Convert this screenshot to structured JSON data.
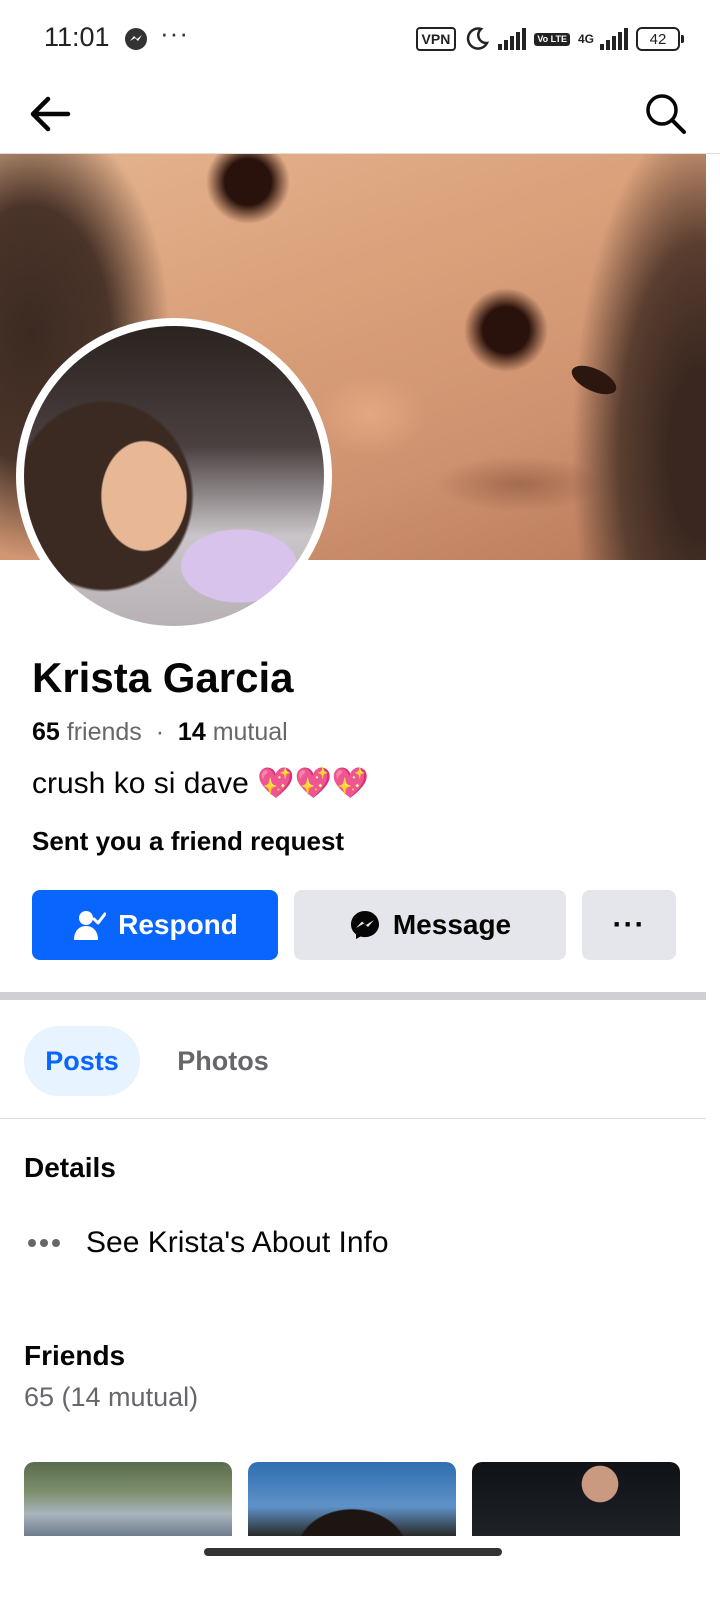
{
  "status_bar": {
    "time": "11:01",
    "overflow": "···",
    "vpn": "VPN",
    "volte": "Vo LTE",
    "network": "4G",
    "battery": "42"
  },
  "profile": {
    "name": "Krista Garcia",
    "friends_count": "65",
    "friends_word": "friends",
    "mutual_count": "14",
    "mutual_word": "mutual",
    "bio": "crush ko si dave 💖💖💖",
    "request_note": "Sent you a friend request"
  },
  "actions": {
    "respond": "Respond",
    "message": "Message",
    "more": "···"
  },
  "tabs": {
    "posts": "Posts",
    "photos": "Photos"
  },
  "details": {
    "heading": "Details",
    "about_link": "See Krista's About Info"
  },
  "friends_section": {
    "heading": "Friends",
    "summary": "65 (14 mutual)"
  },
  "colors": {
    "primary": "#0866ff",
    "tab_active_bg": "#e7f3ff",
    "secondary_button": "#e4e6eb",
    "secondary_text": "#65676b"
  }
}
